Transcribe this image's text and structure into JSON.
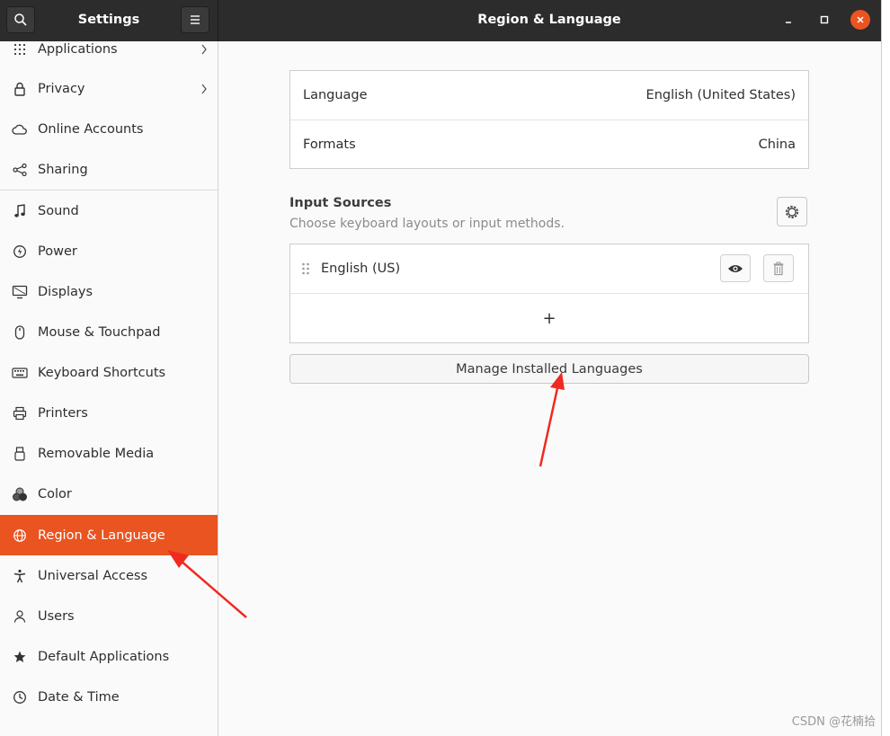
{
  "header": {
    "sidebar_title": "Settings",
    "main_title": "Region & Language",
    "accent_color": "#e95420"
  },
  "sidebar": {
    "items": [
      {
        "label": "Applications",
        "icon": "grid-icon",
        "chevron": true
      },
      {
        "label": "Privacy",
        "icon": "lock-icon",
        "chevron": true
      },
      {
        "label": "Online Accounts",
        "icon": "cloud-icon",
        "chevron": false
      },
      {
        "label": "Sharing",
        "icon": "share-icon",
        "chevron": false
      },
      {
        "label": "Sound",
        "icon": "music-note-icon",
        "chevron": false
      },
      {
        "label": "Power",
        "icon": "power-icon",
        "chevron": false
      },
      {
        "label": "Displays",
        "icon": "display-icon",
        "chevron": false
      },
      {
        "label": "Mouse & Touchpad",
        "icon": "mouse-icon",
        "chevron": false
      },
      {
        "label": "Keyboard Shortcuts",
        "icon": "keyboard-icon",
        "chevron": false
      },
      {
        "label": "Printers",
        "icon": "printer-icon",
        "chevron": false
      },
      {
        "label": "Removable Media",
        "icon": "media-icon",
        "chevron": false
      },
      {
        "label": "Color",
        "icon": "color-icon",
        "chevron": false
      },
      {
        "label": "Region & Language",
        "icon": "globe-icon",
        "chevron": false,
        "active": true
      },
      {
        "label": "Universal Access",
        "icon": "accessibility-icon",
        "chevron": false
      },
      {
        "label": "Users",
        "icon": "users-icon",
        "chevron": false
      },
      {
        "label": "Default Applications",
        "icon": "star-icon",
        "chevron": false
      },
      {
        "label": "Date & Time",
        "icon": "clock-icon",
        "chevron": false
      }
    ]
  },
  "main": {
    "language_label": "Language",
    "language_value": "English (United States)",
    "formats_label": "Formats",
    "formats_value": "China",
    "input_sources_title": "Input Sources",
    "input_sources_subtitle": "Choose keyboard layouts or input methods.",
    "input_source_name": "English (US)",
    "add_symbol": "+",
    "manage_button": "Manage Installed Languages"
  },
  "watermark": "CSDN @花楠拾"
}
